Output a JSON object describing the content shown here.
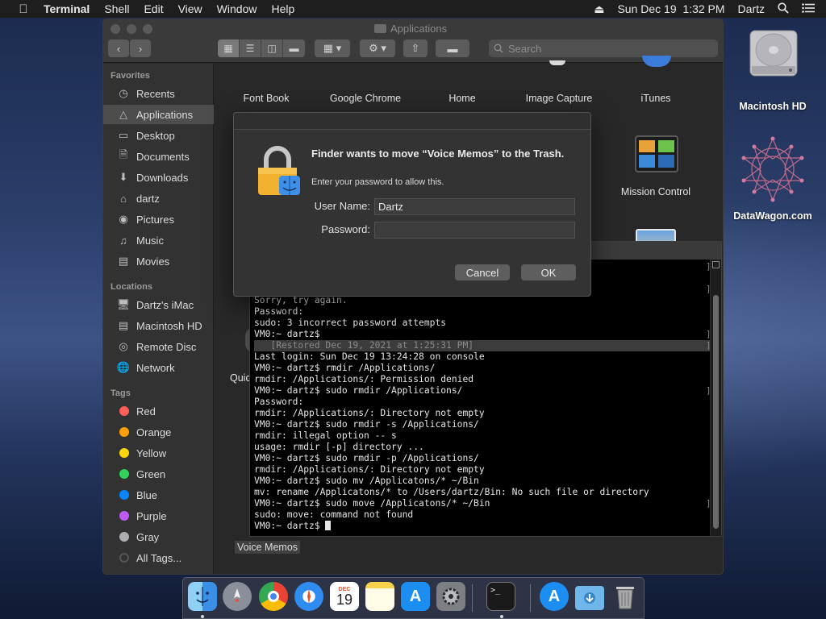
{
  "menubar": {
    "app_name": "Terminal",
    "items": [
      "Shell",
      "Edit",
      "View",
      "Window",
      "Help"
    ],
    "datetime": "Sun Dec 19  1:32 PM",
    "user": "Dartz"
  },
  "finder": {
    "title": "Applications",
    "search_placeholder": "Search",
    "sidebar": {
      "favorites_header": "Favorites",
      "favorites": [
        "Recents",
        "Applications",
        "Desktop",
        "Documents",
        "Downloads",
        "dartz",
        "Pictures",
        "Music",
        "Movies"
      ],
      "locations_header": "Locations",
      "locations": [
        "Dartz's iMac",
        "Macintosh HD",
        "Remote Disc",
        "Network"
      ],
      "tags_header": "Tags",
      "tags": [
        {
          "label": "Red",
          "color": "#ff5f57"
        },
        {
          "label": "Orange",
          "color": "#ff9f0a"
        },
        {
          "label": "Yellow",
          "color": "#ffd60a"
        },
        {
          "label": "Green",
          "color": "#30d158"
        },
        {
          "label": "Blue",
          "color": "#0a84ff"
        },
        {
          "label": "Purple",
          "color": "#bf5af2"
        },
        {
          "label": "Gray",
          "color": "#aeaeb2"
        },
        {
          "label": "All Tags...",
          "color": "#555555"
        }
      ]
    },
    "apps": [
      "Font Book",
      "Google Chrome",
      "Home",
      "Image Capture",
      "iTunes",
      "Mission Control"
    ],
    "partial_label": "Quic",
    "selected_item": "Voice Memos"
  },
  "dialog": {
    "title": "Finder wants to move “Voice Memos” to the Trash.",
    "subtitle": "Enter your password to allow this.",
    "username_label": "User Name:",
    "username_value": "Dartz",
    "password_label": "Password:",
    "password_value": "",
    "cancel_label": "Cancel",
    "ok_label": "OK"
  },
  "terminal": {
    "lines": [
      "Sorry, try again.",
      "Password:",
      "sudo: 3 incorrect password attempts",
      "VM0:~ dartz$",
      "   [Restored Dec 19, 2021 at 1:25:31 PM]",
      "Last login: Sun Dec 19 13:24:28 on console",
      "VM0:~ dartz$ rmdir /Applications/",
      "rmdir: /Applications/: Permission denied",
      "VM0:~ dartz$ sudo rmdir /Applications/",
      "Password:",
      "rmdir: /Applications/: Directory not empty",
      "VM0:~ dartz$ sudo rmdir -s /Applications/",
      "rmdir: illegal option -- s",
      "usage: rmdir [-p] directory ...",
      "VM0:~ dartz$ sudo rmdir -p /Applications/",
      "rmdir: /Applications/: Directory not empty",
      "VM0:~ dartz$ sudo mv /Applicatons/* ~/Bin",
      "mv: rename /Applicatons/* to /Users/dartz/Bin: No such file or directory",
      "VM0:~ dartz$ sudo move /Applicatons/* ~/Bin",
      "sudo: move: command not found",
      "VM0:~ dartz$ "
    ]
  },
  "desktop": {
    "icons": [
      "Macintosh HD",
      "DataWagon.com"
    ]
  }
}
